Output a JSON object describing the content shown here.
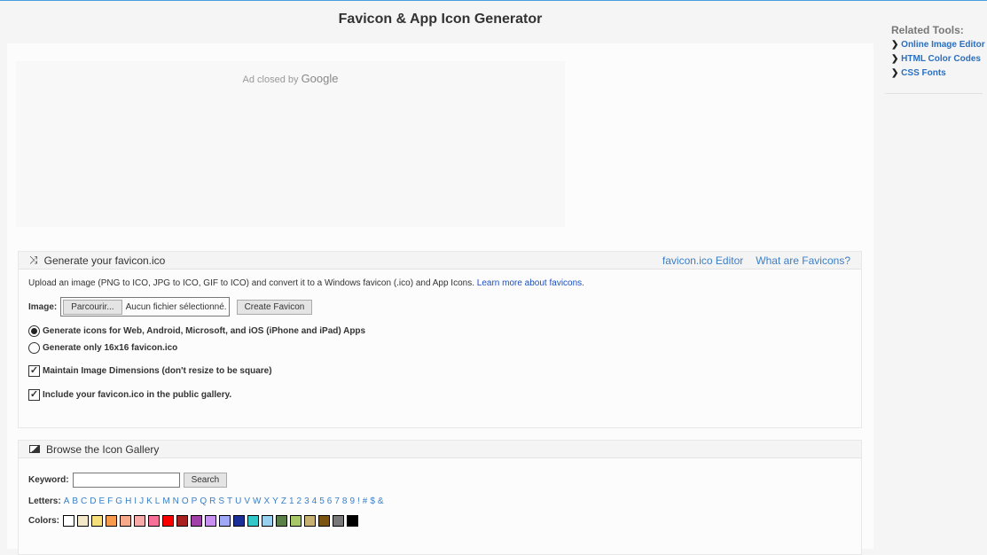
{
  "title": "Favicon & App Icon Generator",
  "ad": {
    "text": "Ad closed by",
    "brand": "Google"
  },
  "sidebar": {
    "title": "Related Tools:",
    "links": [
      "Online Image Editor",
      "HTML Color Codes",
      "CSS Fonts"
    ]
  },
  "generate": {
    "title": "Generate your favicon.ico",
    "links": [
      "favicon.ico Editor",
      "What are Favicons?"
    ],
    "desc": "Upload an image (PNG to ICO, JPG to ICO, GIF to ICO) and convert it to a Windows favicon (.ico) and App Icons.",
    "learn_more": "Learn more about favicons.",
    "image_label": "Image:",
    "browse_label": "Parcourir...",
    "file_status": "Aucun fichier sélectionné.",
    "create_label": "Create Favicon",
    "radio_all": "Generate icons for Web, Android, Microsoft, and iOS (iPhone and iPad) Apps",
    "radio_16": "Generate only 16x16 favicon.ico",
    "radio_selected": "all",
    "check_dimensions": "Maintain Image Dimensions (don't resize to be square)",
    "check_dimensions_on": true,
    "check_gallery": "Include your favicon.ico in the public gallery.",
    "check_gallery_on": true
  },
  "gallery": {
    "title": "Browse the Icon Gallery",
    "keyword_label": "Keyword:",
    "keyword_value": "",
    "search_label": "Search",
    "letters_label": "Letters:",
    "letters": [
      "A",
      "B",
      "C",
      "D",
      "E",
      "F",
      "G",
      "H",
      "I",
      "J",
      "K",
      "L",
      "M",
      "N",
      "O",
      "P",
      "Q",
      "R",
      "S",
      "T",
      "U",
      "V",
      "W",
      "X",
      "Y",
      "Z",
      "1",
      "2",
      "3",
      "4",
      "5",
      "6",
      "7",
      "8",
      "9",
      "!",
      "#",
      "$",
      "&"
    ],
    "colors_label": "Colors:",
    "colors": [
      "#ffffff",
      "#f3e9c9",
      "#f7e07a",
      "#f79a4c",
      "#f8a98a",
      "#f8aaa8",
      "#f76f98",
      "#f80000",
      "#a82020",
      "#a040a8",
      "#c890f0",
      "#a0a8f8",
      "#1a2f98",
      "#30c8c8",
      "#98d0f0",
      "#5a8048",
      "#a8c868",
      "#c8b070",
      "#7a5410",
      "#787878",
      "#000000"
    ]
  }
}
